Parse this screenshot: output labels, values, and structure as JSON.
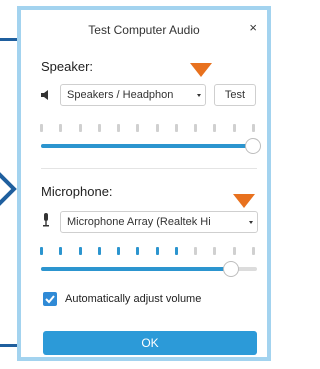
{
  "dialog": {
    "title": "Test Computer Audio",
    "close_glyph": "×"
  },
  "speaker": {
    "label": "Speaker:",
    "icon": "speaker-icon",
    "device": "Speakers / Headphon",
    "test_label": "Test",
    "volume": 1.0,
    "indicator_total": 12,
    "indicator_active": 0
  },
  "microphone": {
    "label": "Microphone:",
    "icon": "microphone-icon",
    "device": "Microphone Array (Realtek Hi",
    "volume": 0.88,
    "indicator_total": 12,
    "indicator_active": 8
  },
  "auto_adjust": {
    "label": "Automatically adjust volume",
    "checked": true
  },
  "ok_label": "OK",
  "colors": {
    "accent": "#2c95cf",
    "frame": "#a3d3ef",
    "callout_arrow": "#e8711e",
    "callout_line": "#1f5f9e"
  }
}
